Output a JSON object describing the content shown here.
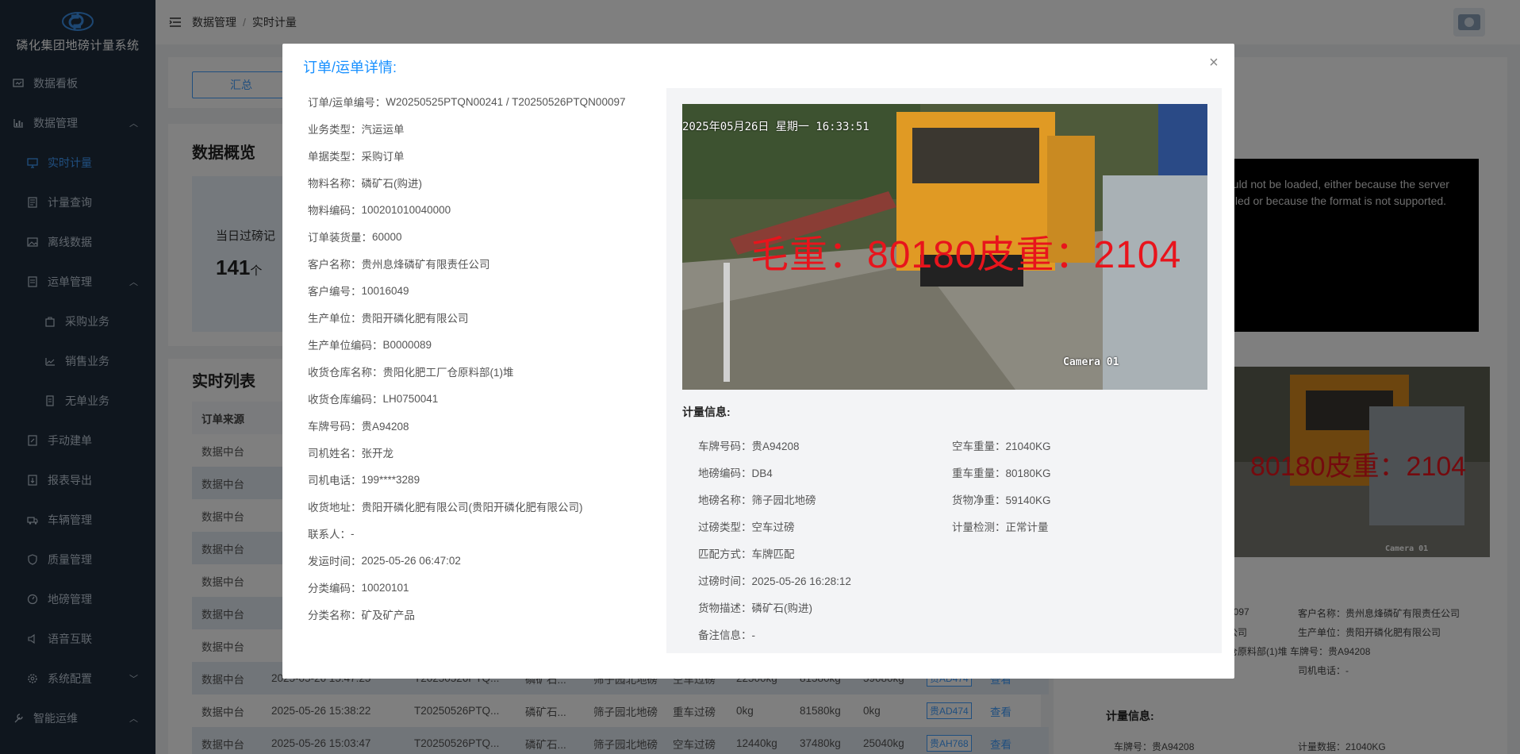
{
  "app": {
    "title": "磷化集团地磅计量系统"
  },
  "sidebar": {
    "items": [
      {
        "label": "数据看板",
        "icon": "dashboard-icon"
      },
      {
        "label": "数据管理",
        "icon": "chart-icon",
        "expanded": true
      },
      {
        "label": "实时计量",
        "icon": "monitor-icon",
        "active": true
      },
      {
        "label": "计量查询",
        "icon": "search-icon"
      },
      {
        "label": "离线数据",
        "icon": "image-icon"
      },
      {
        "label": "运单管理",
        "icon": "document-icon",
        "expanded": true
      },
      {
        "label": "采购业务",
        "icon": "bag-icon"
      },
      {
        "label": "销售业务",
        "icon": "chart-icon"
      },
      {
        "label": "无单业务",
        "icon": "document-icon"
      },
      {
        "label": "手动建单",
        "icon": "edit-doc-icon"
      },
      {
        "label": "报表导出",
        "icon": "export-icon"
      },
      {
        "label": "车辆管理",
        "icon": "truck-icon"
      },
      {
        "label": "质量管理",
        "icon": "shield-icon"
      },
      {
        "label": "地磅管理",
        "icon": "scale-icon"
      },
      {
        "label": "语音互联",
        "icon": "speaker-icon"
      },
      {
        "label": "系统配置",
        "icon": "gear-icon"
      },
      {
        "label": "智能运维",
        "icon": "wrench-icon"
      }
    ]
  },
  "topbar": {
    "breadcrumb_root": "数据管理",
    "breadcrumb_sep": "/",
    "breadcrumb_current": "实时计量"
  },
  "background": {
    "tab_label": "汇总",
    "overview_title": "数据概览",
    "stat_label": "当日过磅记",
    "stat_value": "141",
    "stat_unit": "个",
    "list_title": "实时列表",
    "table_header_first": "订单来源",
    "table_rows": [
      {
        "source": "数据中台"
      },
      {
        "source": "数据中台"
      },
      {
        "source": "数据中台"
      },
      {
        "source": "数据中台"
      },
      {
        "source": "数据中台"
      },
      {
        "source": "数据中台"
      },
      {
        "source": "数据中台"
      },
      {
        "source": "数据中台",
        "time": "2025-05-26 15:47:25",
        "order": "T20250526PTQ...",
        "material": "磷矿石...",
        "scale": "筛子园北地磅",
        "type": "空车过磅",
        "w1": "22500kg",
        "w2": "81580kg",
        "w3": "59080kg",
        "plate": "贵AD474",
        "action": "查看"
      },
      {
        "source": "数据中台",
        "time": "2025-05-26 15:38:22",
        "order": "T20250526PTQ...",
        "material": "磷矿石...",
        "scale": "筛子园北地磅",
        "type": "重车过磅",
        "w1": "0kg",
        "w2": "81580kg",
        "w3": "0kg",
        "plate": "贵AD474",
        "action": "查看"
      },
      {
        "source": "数据中台",
        "time": "2025-05-26 15:03:47",
        "order": "T20250526PTQ...",
        "material": "磷矿石...",
        "scale": "筛子园北地磅",
        "type": "空车过磅",
        "w1": "12440kg",
        "w2": "37480kg",
        "w3": "25040kg",
        "plate": "贵AH768",
        "action": "查看"
      }
    ],
    "error_text": "ould not be loaded, either because the server ailed or because the format is not supported.",
    "rp_lines": [
      {
        "text": "0097"
      },
      {
        "text": "客户名称：贵州息烽磷矿有限责任公司"
      },
      {
        "text": "公司"
      },
      {
        "text": "生产单位：贵阳开磷化肥有限公司"
      },
      {
        "text": "仓原料部(1)堆 车牌号：贵A94208"
      },
      {
        "text": "司机电话：-"
      }
    ],
    "rp_meter_title": "计量信息:",
    "rp_meter_plate": "车牌号：贵A94208",
    "rp_meter_data": "计量数据：21040KG",
    "cam_small_overlay": "80180皮重：2104",
    "cam_small_label": "Camera 01"
  },
  "modal": {
    "title": "订单/运单详情:",
    "close_icon": "close-icon",
    "details": [
      {
        "k": "订单/运单编号：",
        "v": "W20250525PTQN00241 / T20250526PTQN00097"
      },
      {
        "k": "业务类型：",
        "v": "汽运运单"
      },
      {
        "k": "单据类型：",
        "v": "采购订单"
      },
      {
        "k": "物料名称：",
        "v": "磷矿石(购进)"
      },
      {
        "k": "物料编码：",
        "v": "100201010040000"
      },
      {
        "k": "订单装货量：",
        "v": "60000"
      },
      {
        "k": "客户名称：",
        "v": "贵州息烽磷矿有限责任公司"
      },
      {
        "k": "客户编号：",
        "v": "10016049"
      },
      {
        "k": "生产单位：",
        "v": "贵阳开磷化肥有限公司"
      },
      {
        "k": "生产单位编码：",
        "v": "B0000089"
      },
      {
        "k": "收货仓库名称：",
        "v": "贵阳化肥工厂仓原料部(1)堆"
      },
      {
        "k": "收货仓库编码：",
        "v": "LH0750041"
      },
      {
        "k": "车牌号码：",
        "v": "贵A94208"
      },
      {
        "k": "司机姓名：",
        "v": "张开龙"
      },
      {
        "k": "司机电话：",
        "v": "199****3289"
      },
      {
        "k": "收货地址：",
        "v": "贵阳开磷化肥有限公司(贵阳开磷化肥有限公司)"
      },
      {
        "k": "联系人：",
        "v": "-"
      },
      {
        "k": "发运时间：",
        "v": "2025-05-26 06:47:02"
      },
      {
        "k": "分类编码：",
        "v": "10020101"
      },
      {
        "k": "分类名称：",
        "v": "矿及矿产品"
      }
    ],
    "camera": {
      "timestamp": "2025年05月26日  星期一  16:33:51",
      "overlay": "毛重：80180皮重：2104",
      "label": "Camera 01"
    },
    "meter_title": "计量信息:",
    "meter_left": [
      {
        "k": "车牌号码：",
        "v": "贵A94208"
      },
      {
        "k": "地磅编码：",
        "v": "DB4"
      },
      {
        "k": "地磅名称：",
        "v": "筛子园北地磅"
      },
      {
        "k": "过磅类型：",
        "v": "空车过磅"
      },
      {
        "k": "匹配方式：",
        "v": "车牌匹配"
      },
      {
        "k": "过磅时间：",
        "v": "2025-05-26 16:28:12"
      },
      {
        "k": "货物描述：",
        "v": "磷矿石(购进)"
      },
      {
        "k": "备注信息：",
        "v": "-"
      }
    ],
    "meter_right": [
      {
        "k": "空车重量：",
        "v": "21040KG"
      },
      {
        "k": "重车重量：",
        "v": "80180KG"
      },
      {
        "k": "货物净重：",
        "v": "59140KG"
      },
      {
        "k": "计量检测：",
        "v": "正常计量"
      }
    ]
  },
  "colors": {
    "sidebar_bg": "#1f2d3d",
    "accent": "#409eff",
    "modal_title": "#1890ff",
    "overlay_red": "#e8141c"
  }
}
